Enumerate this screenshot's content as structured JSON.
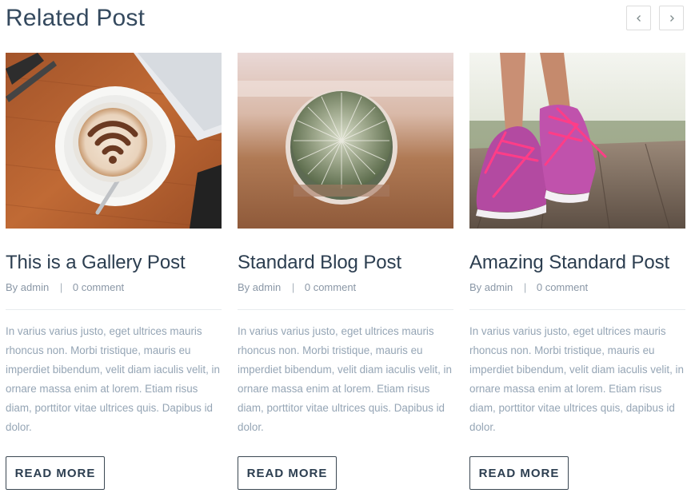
{
  "section": {
    "title": "Related Post"
  },
  "nav": {
    "prev_icon": "chevron-left-icon",
    "next_icon": "chevron-right-icon"
  },
  "posts": [
    {
      "title": "This is a Gallery Post",
      "by": "By",
      "author": "admin",
      "separator": "|",
      "comments": "0 comment",
      "excerpt": "In varius varius justo, eget ultrices mauris rhoncus non. Morbi tristique, mauris eu imperdiet bibendum, velit diam iaculis velit, in ornare massa enim at lorem. Etiam risus diam, porttitor vitae ultrices quis. Dapibus id dolor.",
      "button": "READ MORE"
    },
    {
      "title": "Standard Blog Post",
      "by": "By",
      "author": "admin",
      "separator": "|",
      "comments": "0 comment",
      "excerpt": "In varius varius justo, eget ultrices mauris rhoncus non. Morbi tristique, mauris eu imperdiet bibendum, velit diam iaculis velit, in ornare massa enim at lorem. Etiam risus diam, porttitor vitae ultrices quis. Dapibus id dolor.",
      "button": "READ MORE"
    },
    {
      "title": "Amazing Standard Post",
      "by": "By",
      "author": "admin",
      "separator": "|",
      "comments": "0 comment",
      "excerpt": "In varius varius justo, eget ultrices mauris rhoncus non. Morbi tristique, mauris eu imperdiet bibendum, velit diam iaculis velit, in ornare massa enim at lorem. Etiam risus diam, porttitor vitae ultrices quis, dapibus id dolor.",
      "button": "READ MORE"
    }
  ],
  "colors": {
    "heading": "#34495e",
    "meta": "#8a97a6",
    "excerpt": "#95a5b5",
    "border": "#3b4752"
  }
}
